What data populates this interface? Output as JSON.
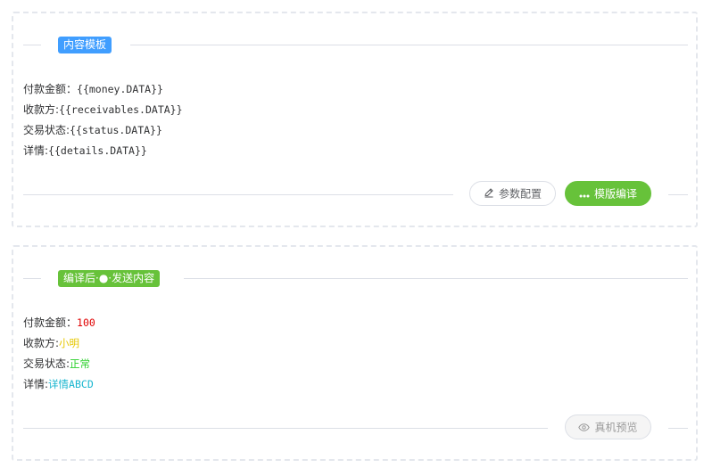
{
  "template_panel": {
    "tag": "内容模板",
    "lines": [
      {
        "key": "付款金额：",
        "value": "{{money.DATA}}"
      },
      {
        "key": "收款方:",
        "value": "{{receivables.DATA}}"
      },
      {
        "key": "交易状态:",
        "value": "{{status.DATA}}"
      },
      {
        "key": "详情:",
        "value": "{{details.DATA}}"
      }
    ],
    "config_button": "参数配置",
    "compile_button": "模版编译"
  },
  "compiled_panel": {
    "tag": "编译后·●·发送内容",
    "lines": [
      {
        "key": "付款金额：",
        "value": "100",
        "color": "#e00000"
      },
      {
        "key": "收款方:",
        "value": "小明",
        "color": "#e6c700"
      },
      {
        "key": "交易状态:",
        "value": "正常",
        "color": "#2bd02b"
      },
      {
        "key": "详情:",
        "value": "详情ABCD",
        "color": "#18b6cf"
      }
    ],
    "preview_button": "真机预览"
  },
  "colors": {
    "primary": "#409eff",
    "success": "#67c23a",
    "border_dashed": "#e4e7ed"
  },
  "icons": {
    "config": "edit-pencil-icon",
    "compile": "more-dots-icon",
    "preview": "eye-icon"
  }
}
